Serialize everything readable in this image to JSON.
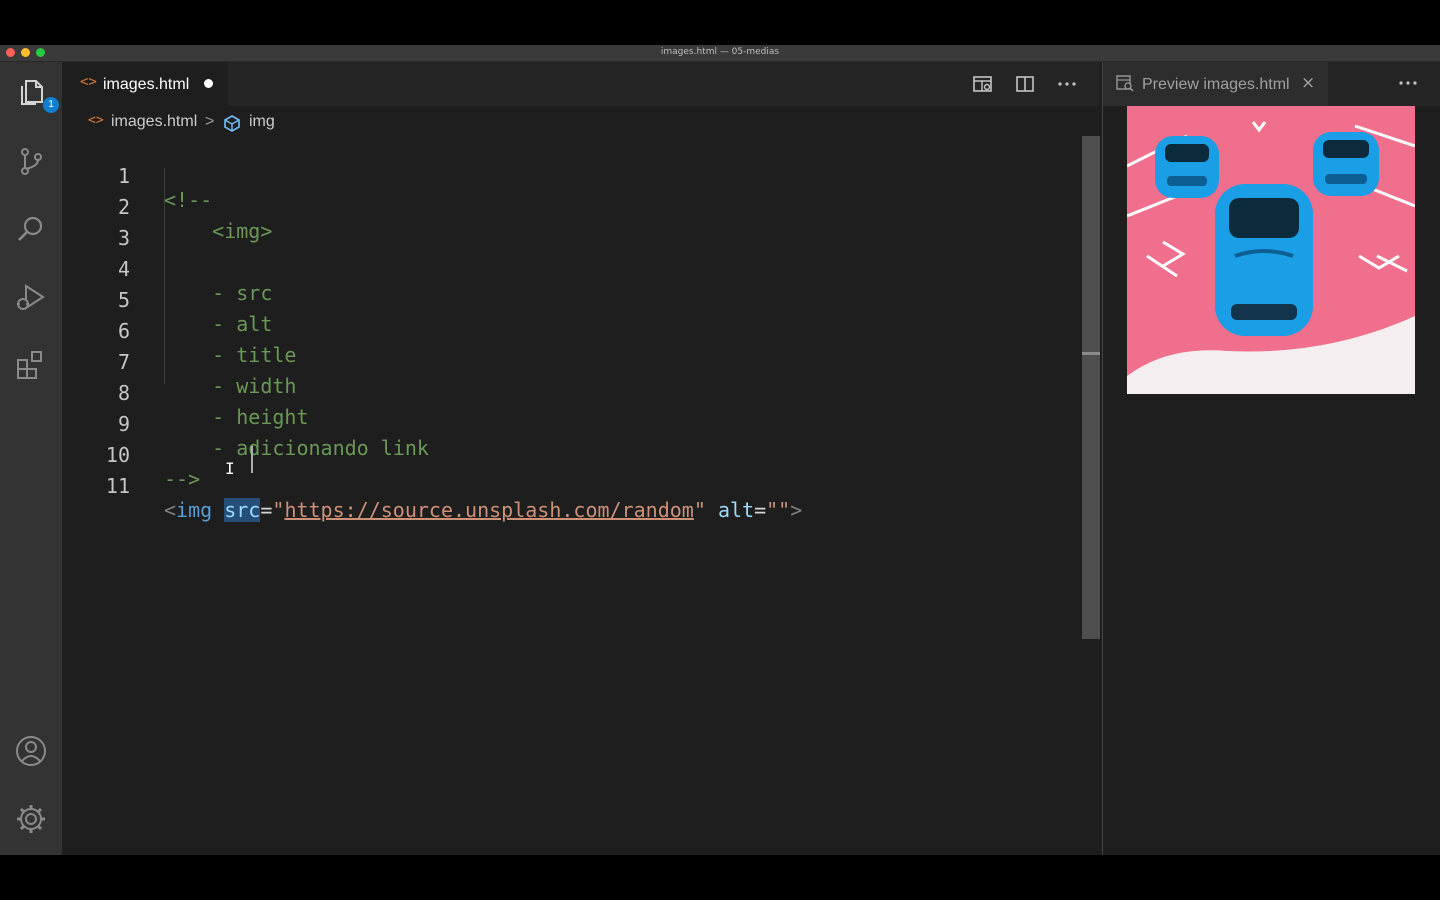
{
  "window": {
    "title": "images.html — 05-medias",
    "traffic_lights": [
      "#ff5f57",
      "#febc2e",
      "#28c840"
    ]
  },
  "activity_bar": {
    "explorer_badge": "1",
    "icons": [
      "files-icon",
      "source-control-icon",
      "search-icon",
      "run-debug-icon",
      "extensions-icon",
      "account-icon",
      "settings-gear-icon"
    ]
  },
  "editor": {
    "tab": {
      "label": "images.html",
      "icon": "html-file-icon",
      "modified": true
    },
    "toolbar_icons": [
      "open-preview-icon",
      "split-editor-icon",
      "more-actions-icon"
    ],
    "breadcrumb": {
      "file": "images.html",
      "separator": ">",
      "symbol": "img"
    },
    "lines": [
      {
        "n": "1",
        "text": "<!--"
      },
      {
        "n": "2",
        "text": "    <img>"
      },
      {
        "n": "3",
        "text": ""
      },
      {
        "n": "4",
        "text": "    - src"
      },
      {
        "n": "5",
        "text": "    - alt"
      },
      {
        "n": "6",
        "text": "    - title"
      },
      {
        "n": "7",
        "text": "    - width"
      },
      {
        "n": "8",
        "text": "    - height"
      },
      {
        "n": "9",
        "text": "    - adicionando link"
      },
      {
        "n": "10",
        "text": "-->"
      },
      {
        "n": "11",
        "text": "<img src=\"https://source.unsplash.com/random\" alt=\"\">"
      }
    ],
    "line11": {
      "lt": "<",
      "tag": "img",
      "attr1": "src",
      "eq1": "=",
      "q": "\"",
      "url": "https://source.unsplash.com/random",
      "attr2": "alt",
      "eq2": "=",
      "empty_val": "\"\"",
      "gt": ">"
    }
  },
  "preview": {
    "tab_label": "Preview images.html",
    "close_glyph": "×",
    "image_description": "three-blue-mustangs-on-pink-parking-deck",
    "colors": {
      "car": "#1a9ee6",
      "ground": "#f06d8a"
    }
  }
}
